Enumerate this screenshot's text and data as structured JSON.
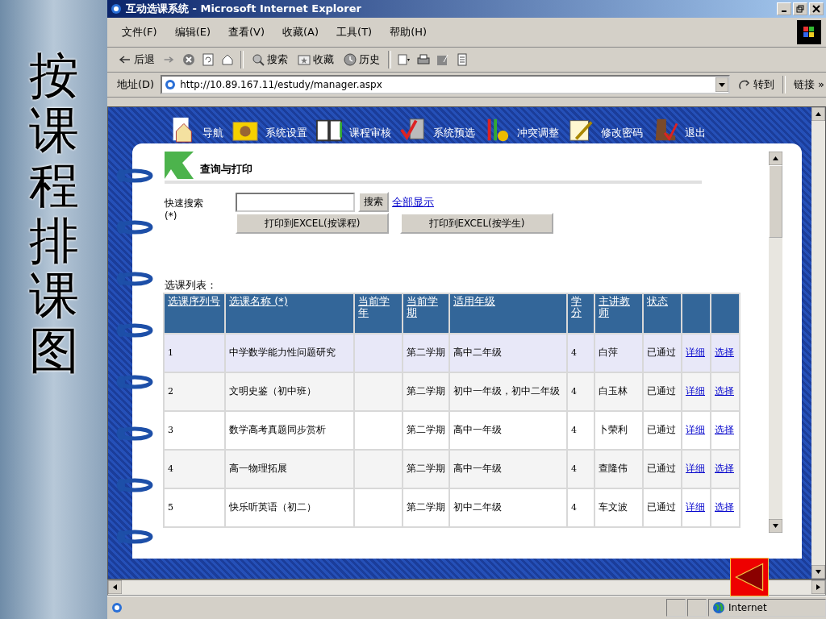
{
  "slide_title": "按课程排课图",
  "window": {
    "title": "互动选课系统 - Microsoft Internet Explorer"
  },
  "menu": [
    "文件(F)",
    "编辑(E)",
    "查看(V)",
    "收藏(A)",
    "工具(T)",
    "帮助(H)"
  ],
  "toolbar": {
    "back": "后退",
    "search": "搜索",
    "favorites": "收藏",
    "history": "历史"
  },
  "address_bar": {
    "label": "地址(D)",
    "url": "http://10.89.167.11/estudy/manager.aspx",
    "go": "转到",
    "links": "链接 »"
  },
  "nav": [
    "导航",
    "系统设置",
    "课程审核",
    "系统预选",
    "冲突调整",
    "修改密码",
    "退出"
  ],
  "section_title": "查询与打印",
  "search": {
    "label": "快速搜索",
    "note": "(*)",
    "button": "搜索",
    "show_all": "全部显示"
  },
  "print_buttons": [
    "打印到EXCEL(按课程)",
    "打印到EXCEL(按学生)"
  ],
  "list_label": "选课列表：",
  "table": {
    "columns": [
      "选课序列号",
      "选课名称 (*)",
      "当前学年",
      "当前学期",
      "适用年级",
      "学分",
      "主讲教师",
      "状态"
    ],
    "rows": [
      {
        "selected": true,
        "cells": [
          "1",
          "中学数学能力性问题研究",
          "",
          "第二学期",
          "高中二年级",
          "4",
          "白萍",
          "已通过"
        ],
        "detail": "详细",
        "choose": "选择"
      },
      {
        "selected": false,
        "cells": [
          "2",
          "文明史鉴（初中班）",
          "",
          "第二学期",
          "初中一年级，初中二年级",
          "4",
          "白玉林",
          "已通过"
        ],
        "detail": "详细",
        "choose": "选择"
      },
      {
        "selected": false,
        "cells": [
          "3",
          "数学高考真题同步赏析",
          "",
          "第二学期",
          "高中一年级",
          "4",
          "卜荣利",
          "已通过"
        ],
        "detail": "详细",
        "choose": "选择"
      },
      {
        "selected": false,
        "cells": [
          "4",
          "高一物理拓展",
          "",
          "第二学期",
          "高中一年级",
          "4",
          "查隆伟",
          "已通过"
        ],
        "detail": "详细",
        "choose": "选择"
      },
      {
        "selected": false,
        "cells": [
          "5",
          "快乐听英语（初二）",
          "",
          "第二学期",
          "初中二年级",
          "4",
          "车文波",
          "已通过"
        ],
        "detail": "详细",
        "choose": "选择"
      }
    ]
  },
  "status_bar": {
    "zone": "Internet"
  }
}
